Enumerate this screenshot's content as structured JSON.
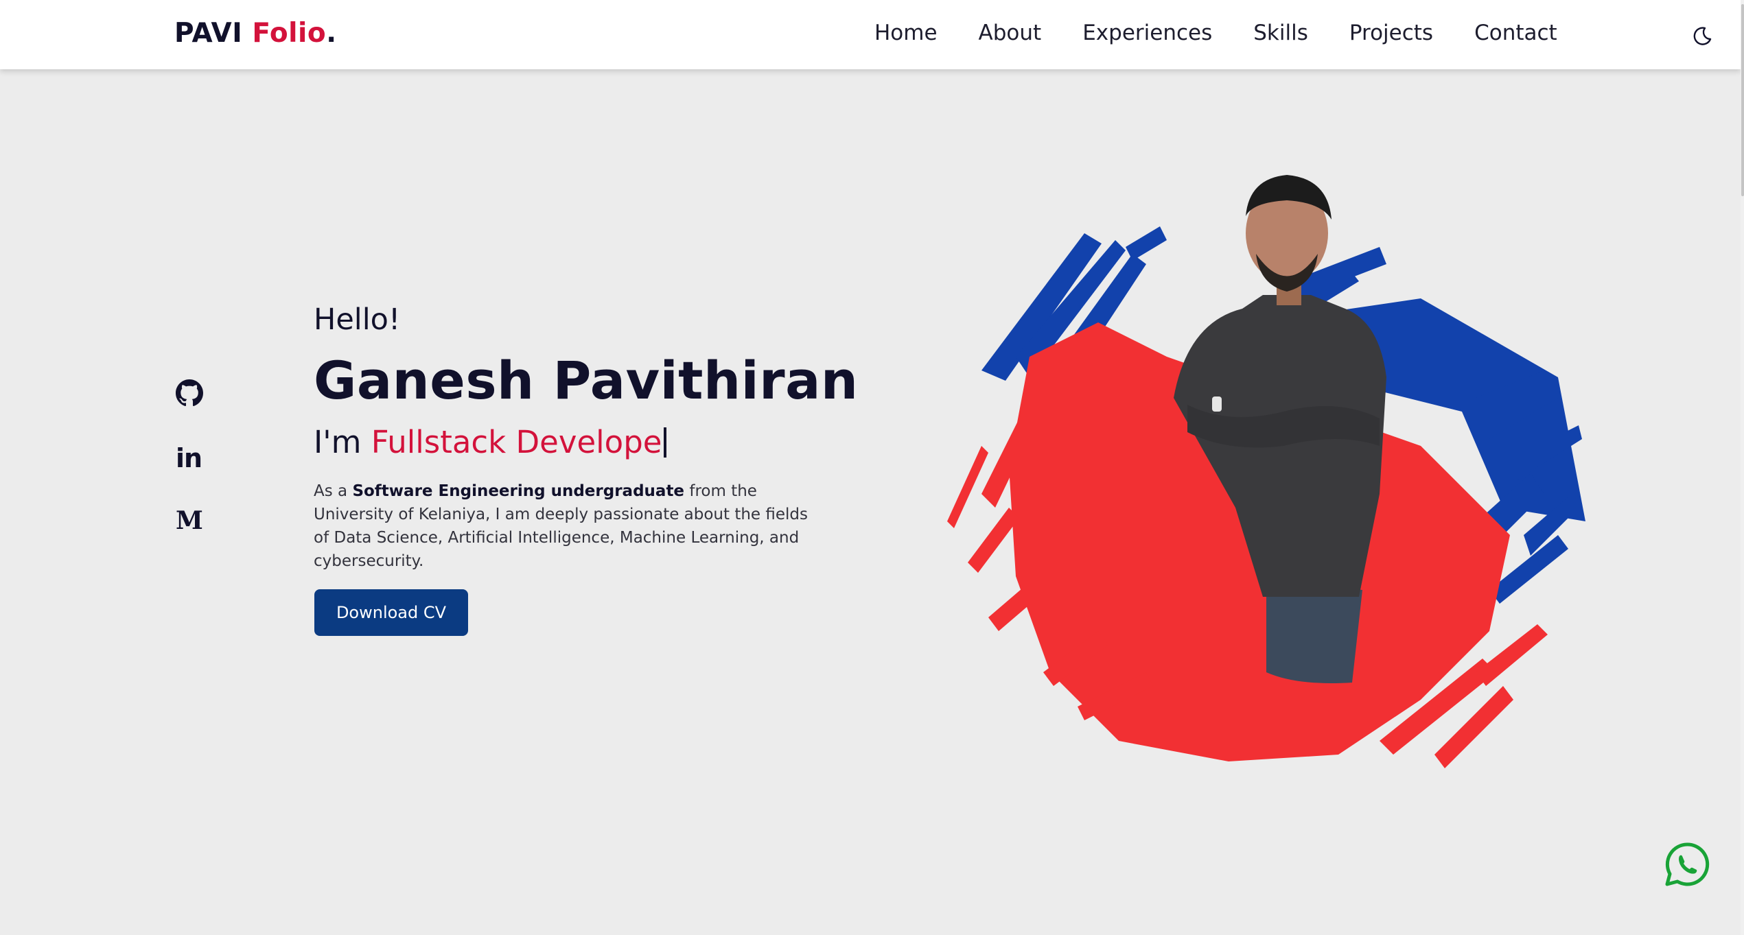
{
  "navbar": {
    "logo": {
      "first": "PAVI",
      "accent": "Folio",
      "dot": "."
    },
    "links": [
      {
        "label": "Home"
      },
      {
        "label": "About"
      },
      {
        "label": "Experiences"
      },
      {
        "label": "Skills"
      },
      {
        "label": "Projects"
      },
      {
        "label": "Contact"
      }
    ],
    "theme_toggle_icon": "moon-icon"
  },
  "social": [
    {
      "icon": "github-icon"
    },
    {
      "icon": "linkedin-icon",
      "glyph": "in"
    },
    {
      "icon": "medium-icon",
      "glyph": "M"
    }
  ],
  "hero": {
    "greeting": "Hello!",
    "name": "Ganesh Pavithiran",
    "role_prefix": "I'm ",
    "role_value": "Fullstack Develope",
    "description": {
      "before": "As a ",
      "bold": "Software Engineering undergraduate",
      "after": " from the University of Kelaniya, I am deeply passionate about the fields of Data Science, Artificial Intelligence, Machine Learning, and cybersecurity."
    },
    "cv_button": "Download CV",
    "image_icon": "profile-photo"
  },
  "floating": {
    "whatsapp_icon": "whatsapp-icon"
  },
  "colors": {
    "accent": "#d3123b",
    "button": "#0b3b82",
    "paint_red": "#f23033",
    "paint_blue": "#1242ac",
    "background": "#ececec",
    "text": "#11112b"
  }
}
